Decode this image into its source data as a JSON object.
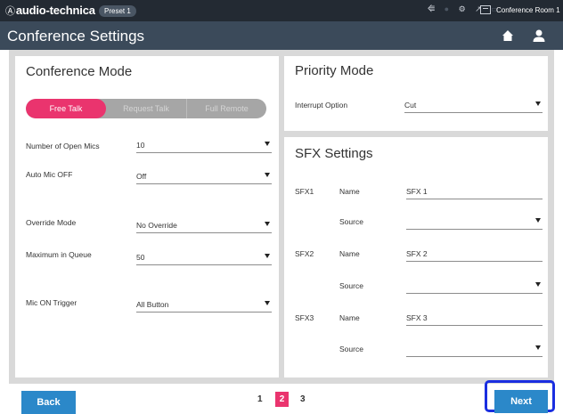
{
  "topbar": {
    "logo": "audio-technica",
    "logo_mark": "Ⓐ",
    "preset": "Preset  1",
    "icons": [
      "usb-icon",
      "dot-icon",
      "gear-icon",
      "network-icon",
      "battery-icon"
    ],
    "room_name": "Conference Room 1"
  },
  "titlebar": {
    "title": "Conference Settings"
  },
  "conference_mode": {
    "title": "Conference Mode",
    "modes": [
      "Free Talk",
      "Request Talk",
      "Full Remote"
    ],
    "active_mode": "Free Talk",
    "settings": [
      {
        "label": "Number of Open Mics",
        "value": "10"
      },
      {
        "label": "Auto Mic OFF",
        "value": "Off"
      },
      {
        "label": "Override Mode",
        "value": "No Override"
      },
      {
        "label": "Maximum in Queue",
        "value": "50"
      },
      {
        "label": "Mic ON Trigger",
        "value": "All Button"
      }
    ]
  },
  "priority_mode": {
    "title": "Priority Mode",
    "interrupt_label": "Interrupt Option",
    "interrupt_value": "Cut"
  },
  "sfx_settings": {
    "title": "SFX Settings",
    "items": [
      {
        "id": "SFX1",
        "name_label": "Name",
        "name": "SFX 1",
        "source_label": "Source",
        "source": ""
      },
      {
        "id": "SFX2",
        "name_label": "Name",
        "name": "SFX 2",
        "source_label": "Source",
        "source": ""
      },
      {
        "id": "SFX3",
        "name_label": "Name",
        "name": "SFX 3",
        "source_label": "Source",
        "source": ""
      }
    ]
  },
  "footer": {
    "back_label": "Back",
    "next_label": "Next",
    "pages": [
      "1",
      "2",
      "3"
    ],
    "current_page": "2"
  },
  "colors": {
    "accent": "#ea346e",
    "button": "#2b88c9",
    "titlebar": "#3b4a5a",
    "topbar": "#232a33",
    "highlight_frame": "#1a2ee0"
  }
}
